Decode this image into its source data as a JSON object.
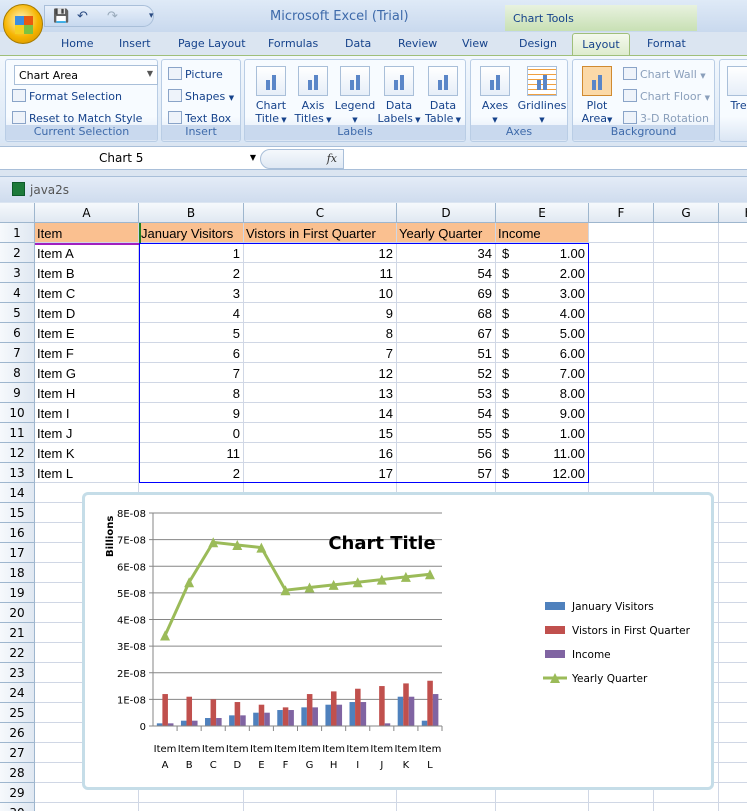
{
  "window": {
    "title": "Microsoft Excel (Trial)",
    "context_tab_group": "Chart Tools"
  },
  "tabs": [
    "Home",
    "Insert",
    "Page Layout",
    "Formulas",
    "Data",
    "Review",
    "View",
    "Design",
    "Layout",
    "Format"
  ],
  "active_tab": "Layout",
  "ribbon": {
    "current_selection": {
      "label": "Current Selection",
      "dropdown_value": "Chart Area",
      "format_selection": "Format Selection",
      "reset": "Reset to Match Style"
    },
    "insert": {
      "label": "Insert",
      "picture": "Picture",
      "shapes": "Shapes",
      "text_box": "Text Box"
    },
    "labels": {
      "label": "Labels",
      "buttons": [
        [
          "Chart",
          "Title"
        ],
        [
          "Axis",
          "Titles"
        ],
        [
          "Legend",
          ""
        ],
        [
          "Data",
          "Labels"
        ],
        [
          "Data",
          "Table"
        ]
      ]
    },
    "axes": {
      "label": "Axes",
      "buttons": [
        "Axes",
        "Gridlines"
      ]
    },
    "background": {
      "label": "Background",
      "plot_area": [
        "Plot",
        "Area"
      ],
      "chart_wall": "Chart Wall",
      "chart_floor": "Chart Floor",
      "rotation": "3-D Rotation"
    },
    "partial": "Tren"
  },
  "formula_bar": {
    "name_box": "Chart 5",
    "fx": "fx",
    "value": ""
  },
  "workbook": {
    "title": "java2s"
  },
  "sheet": {
    "columns": [
      "A",
      "B",
      "C",
      "D",
      "E",
      "F",
      "G",
      "H"
    ],
    "headers": [
      "Item",
      "January Visitors",
      "Vistors in First Quarter",
      "Yearly Quarter",
      "Income"
    ],
    "rows": [
      [
        "Item A",
        "1",
        "12",
        "34",
        "1.00"
      ],
      [
        "Item B",
        "2",
        "11",
        "54",
        "2.00"
      ],
      [
        "Item C",
        "3",
        "10",
        "69",
        "3.00"
      ],
      [
        "Item D",
        "4",
        "9",
        "68",
        "4.00"
      ],
      [
        "Item E",
        "5",
        "8",
        "67",
        "5.00"
      ],
      [
        "Item F",
        "6",
        "7",
        "51",
        "6.00"
      ],
      [
        "Item G",
        "7",
        "12",
        "52",
        "7.00"
      ],
      [
        "Item H",
        "8",
        "13",
        "53",
        "8.00"
      ],
      [
        "Item I",
        "9",
        "14",
        "54",
        "9.00"
      ],
      [
        "Item J",
        "0",
        "15",
        "55",
        "1.00"
      ],
      [
        "Item K",
        "11",
        "16",
        "56",
        "11.00"
      ],
      [
        "Item L",
        "2",
        "17",
        "57",
        "12.00"
      ]
    ],
    "currency_symbol": "$",
    "row_count": 30
  },
  "chart_data": {
    "type": "bar",
    "title": "Chart Title",
    "ylabel": "Billions",
    "categories": [
      [
        "Item",
        "A"
      ],
      [
        "Item",
        "B"
      ],
      [
        "Item",
        "C"
      ],
      [
        "Item",
        "D"
      ],
      [
        "Item",
        "E"
      ],
      [
        "Item",
        "F"
      ],
      [
        "Item",
        "G"
      ],
      [
        "Item",
        "H"
      ],
      [
        "Item",
        "I"
      ],
      [
        "Item",
        "J"
      ],
      [
        "Item",
        "K"
      ],
      [
        "Item",
        "L"
      ]
    ],
    "ylim": [
      0,
      8e-08
    ],
    "yticks": [
      "0",
      "1E-08",
      "2E-08",
      "3E-08",
      "4E-08",
      "5E-08",
      "6E-08",
      "7E-08",
      "8E-08"
    ],
    "grid": true,
    "legend_position": "right",
    "series": [
      {
        "name": "January Visitors",
        "kind": "bar",
        "color": "#4f81bd",
        "values": [
          1e-09,
          2e-09,
          3e-09,
          4e-09,
          5e-09,
          6e-09,
          7e-09,
          8e-09,
          9e-09,
          0,
          1.1e-08,
          2e-09
        ]
      },
      {
        "name": "Vistors in First Quarter",
        "kind": "bar",
        "color": "#c0504d",
        "values": [
          1.2e-08,
          1.1e-08,
          1e-08,
          9e-09,
          8e-09,
          7e-09,
          1.2e-08,
          1.3e-08,
          1.4e-08,
          1.5e-08,
          1.6e-08,
          1.7e-08
        ]
      },
      {
        "name": "Income",
        "kind": "bar",
        "color": "#8064a2",
        "values": [
          1e-09,
          2e-09,
          3e-09,
          4e-09,
          5e-09,
          6e-09,
          7e-09,
          8e-09,
          9e-09,
          1e-09,
          1.1e-08,
          1.2e-08
        ]
      },
      {
        "name": "Yearly Quarter",
        "kind": "line",
        "color": "#9bbb59",
        "marker": "triangle",
        "values": [
          3.4e-08,
          5.4e-08,
          6.9e-08,
          6.8e-08,
          6.7e-08,
          5.1e-08,
          5.2e-08,
          5.3e-08,
          5.4e-08,
          5.5e-08,
          5.6e-08,
          5.7e-08
        ]
      }
    ]
  }
}
